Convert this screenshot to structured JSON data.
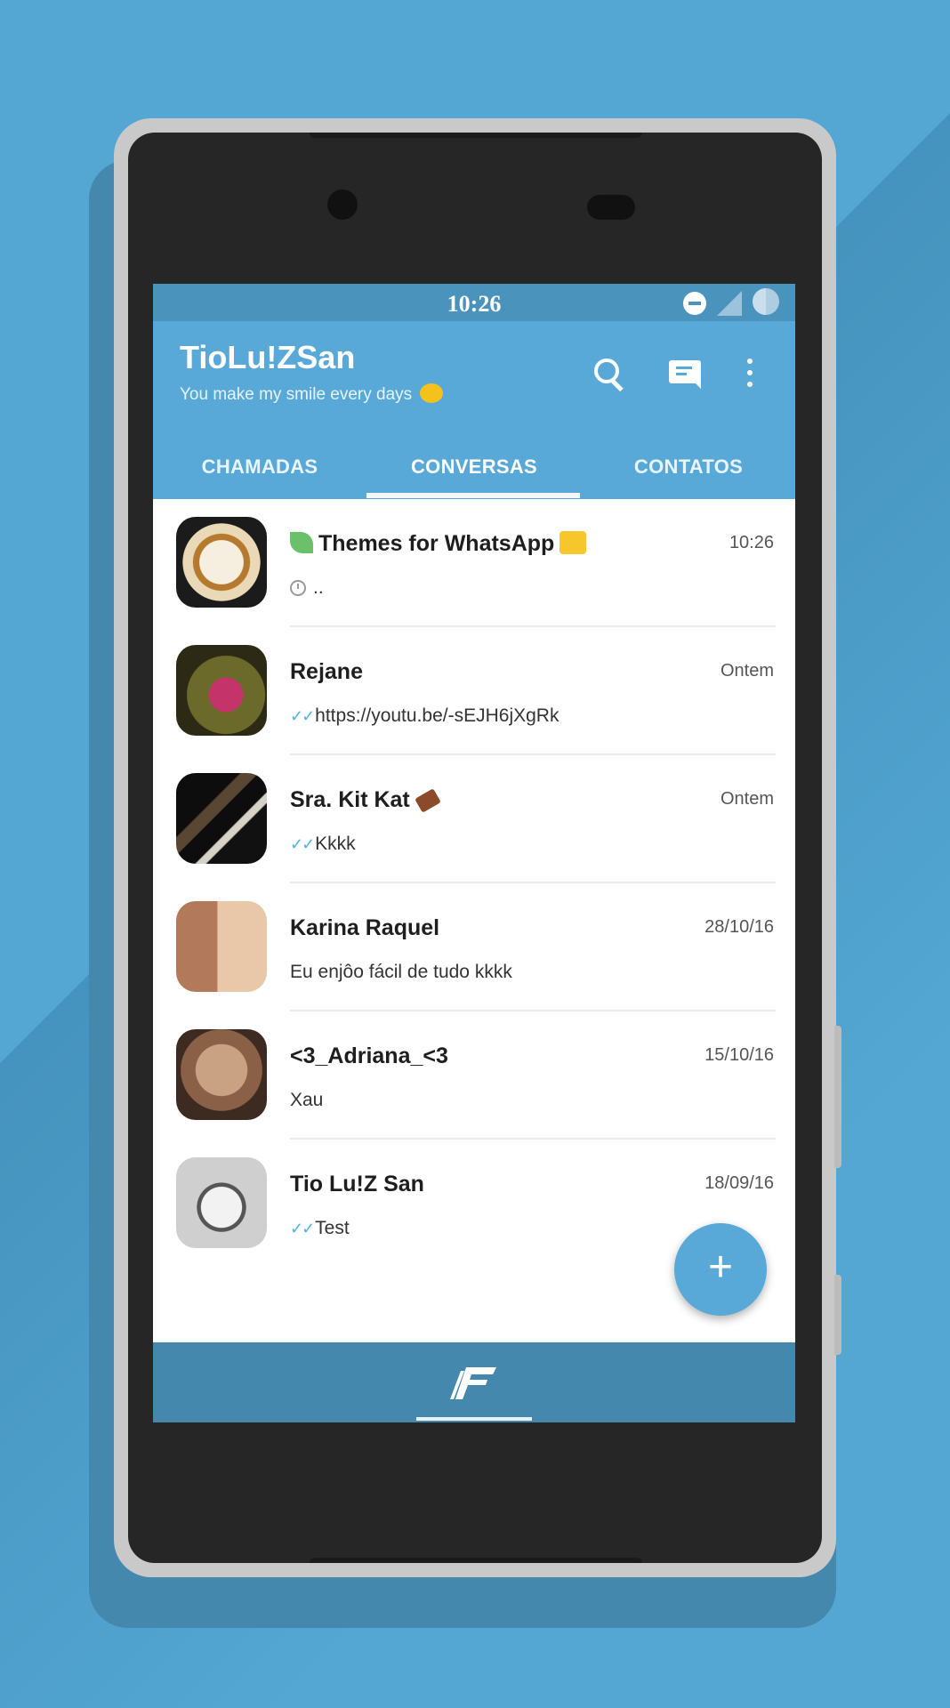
{
  "status_bar": {
    "time": "10:26"
  },
  "app_bar": {
    "title": "TioLu!ZSan",
    "subtitle": "You make my smile every days",
    "icons": [
      "search-icon",
      "new-chat-icon",
      "more-vert-icon"
    ]
  },
  "tabs": [
    {
      "label": "CHAMADAS",
      "active": false
    },
    {
      "label": "CONVERSAS",
      "active": true
    },
    {
      "label": "CONTATOS",
      "active": false
    }
  ],
  "chats": [
    {
      "name": "Themes for WhatsApp",
      "time": "10:26",
      "preview": "..",
      "preview_icon": "clock-icon"
    },
    {
      "name": "Rejane",
      "time": "Ontem",
      "preview": "https://youtu.be/-sEJH6jXgRk",
      "preview_icon": "double-check-icon"
    },
    {
      "name": "Sra. Kit Kat",
      "time": "Ontem",
      "preview": "Kkkk",
      "preview_icon": "double-check-icon"
    },
    {
      "name": "Karina Raquel",
      "time": "28/10/16",
      "preview": "Eu enjôo fácil de tudo kkkk"
    },
    {
      "name": "<3_Adriana_<3",
      "time": "15/10/16",
      "preview": "Xau"
    },
    {
      "name": "Tio Lu!Z San",
      "time": "18/09/16",
      "preview": "Test",
      "preview_icon": "double-check-icon"
    }
  ],
  "fab": {
    "label": "+"
  },
  "colors": {
    "accent": "#58a9d8",
    "status_bar": "#4a93bd",
    "bottom_bar": "#4488ad",
    "background": "#54a7d3"
  }
}
